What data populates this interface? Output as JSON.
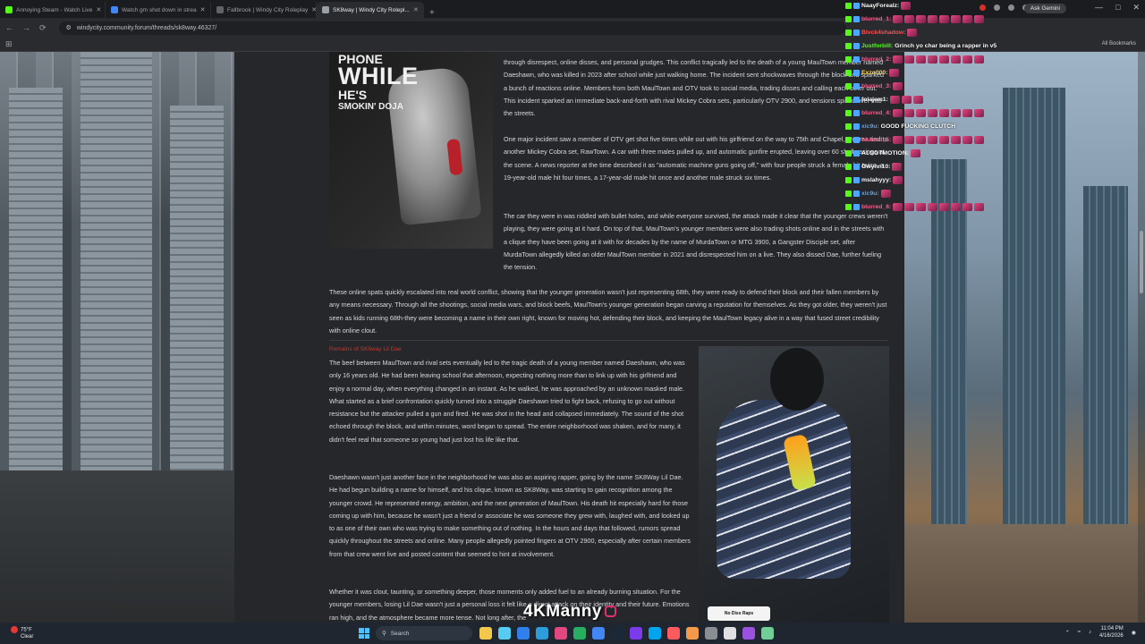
{
  "browser": {
    "tabs": [
      {
        "title": "Annoying Steam - Watch Live",
        "favicon_color": "#53fc18",
        "active": false
      },
      {
        "title": "Watch gm shot down in strea",
        "favicon_color": "#4285f4",
        "active": false
      },
      {
        "title": "Fallbrook | Windy City Roleplay",
        "favicon_color": "#5f6368",
        "active": false
      },
      {
        "title": "SK8way | Windy City Rolepl...",
        "favicon_color": "#9aa0a6",
        "active": true
      }
    ],
    "url": "windycity.community.forum/threads/sk8way.46327/",
    "ask_gemini": "Ask Gemini",
    "all_bookmarks": "All Bookmarks"
  },
  "image_top": {
    "line1": "PHONE",
    "line2": "WHILE",
    "line3": "HE'S",
    "line4": "SMOKIN' DOJA"
  },
  "post": {
    "paragraphs": [
      "through disrespect, online disses, and personal grudges. This conflict tragically led to the death of a young MaulTown member named Daeshawn, who was killed in 2023 after school while just walking home. The incident sent shockwaves through the block and sparked a bunch of reactions online. Members from both MaulTown and OTV took to social media, trading disses and calling each other out. This incident sparked an immediate back-and-forth with rival Mickey Cobra sets, particularly OTV 2900, and tensions spilled over into the streets.",
      "One major incident saw a member of OTV get shot five times while out with his girlfriend on the way to 75th and Chapel, an area tied to another Mickey Cobra set, RawTown. A car with three males pulled up, and automatic gunfire erupted, leaving over 60 shell casings at the scene. A news reporter at the time described it as \"automatic machine guns going off,\" with four people struck a female hit twice, a 19-year-old male hit four times, a 17-year-old male hit once and another male struck six times.",
      "The car they were in was riddled with bullet holes, and while everyone survived, the attack made it clear that the younger crews weren't playing, they were going at it hard. On top of that, MaulTown's younger members were also trading shots online and in the streets with a clique they have been going at it with for decades by the name of MurdaTown or MTG 3900, a Gangster Disciple set, after MurdaTown allegedly killed an older MaulTown member in 2021 and disrespected him on a live. They also dissed Dae, further fueling the tension.",
      "These online spats quickly escalated into real world conflict, showing that the younger generation wasn't just representing 68th, they were ready to defend their block and their fallen members by any means necessary. Through all the shootings, social media wars, and block beefs, MaulTown's younger generation began carving a reputation for themselves. As they got older, they weren't just seen as kids running 68th-they were becoming a name in their own right, known for moving hot, defending their block, and keeping the MaulTown legacy alive in a way that fused street credibility with online clout.",
      "The beef between MaulTown and rival sets eventually led to the tragic death of a young member named Daeshawn, who was only 16 years old. He had been leaving school that afternoon, expecting nothing more than to link up with his girlfriend and enjoy a normal day, when everything changed in an instant. As he walked, he was approached by an unknown masked male. What started as a brief confrontation quickly turned into a struggle Daeshawn tried to fight back, refusing to go out without resistance but the attacker pulled a gun and fired. He was shot in the head and collapsed immediately. The sound of the shot echoed through the block, and within minutes, word began to spread. The entire neighborhood was shaken, and for many, it didn't feel real that someone so young had just lost his life like that.",
      "Daeshawn wasn't just another face in the neighborhood he was also an aspiring rapper, going by the name SK8Way Lil Dae. He had begun building a name for himself, and his clique, known as SK8Way, was starting to gain recognition among the younger crowd. He represented energy, ambition, and the next generation of MaulTown. His death hit especially hard for those coming up with him, because he wasn't just a friend or associate he was someone they grew with, laughed with, and looked up to as one of their own who was trying to make something out of nothing. In the hours and days that followed, rumors spread quickly throughout the streets and online. Many people allegedly pointed fingers at OTV 2900, especially after certain members from that crew went live and posted content that seemed to hint at involvement.",
      "Whether it was clout, taunting, or something deeper, those moments only added fuel to an already burning situation. For the younger members, losing Lil Dae wasn't just a personal loss it felt like a direct attack on their identity and their future. Emotions ran high, and the atmosphere became more tense. Not long after, the"
    ],
    "caption": "Remains of SK8way Lil Dae",
    "sign_text": "No Diss Raps"
  },
  "chat": [
    {
      "user": "NaayForealz:",
      "color": "#f5f5f5",
      "msg": "",
      "emotes": 1
    },
    {
      "user": "blurred_1:",
      "color": "#ff5a8a",
      "msg": "",
      "emotes": 8
    },
    {
      "user": "Blvck4shadow:",
      "color": "#ff4d4d",
      "msg": "",
      "emotes": 1
    },
    {
      "user": "Justforbill:",
      "color": "#53fc18",
      "msg": "Grinch yo char being a rapper in v5",
      "emotes": 0
    },
    {
      "user": "blurred_2:",
      "color": "#ff5a8a",
      "msg": "",
      "emotes": 8
    },
    {
      "user": "Exzo000:",
      "color": "#ffd34d",
      "msg": "",
      "emotes": 1
    },
    {
      "user": "blurred_3:",
      "color": "#ff5a8a",
      "msg": "",
      "emotes": 1
    },
    {
      "user": "folajem1:",
      "color": "#f5f5f5",
      "msg": "",
      "emotes": 3
    },
    {
      "user": "blurred_4:",
      "color": "#ff5a8a",
      "msg": "",
      "emotes": 8
    },
    {
      "user": "xic9u:",
      "color": "#4da6ff",
      "msg": "GOOD FUCKING CLUTCH",
      "emotes": 0
    },
    {
      "user": "blurred_5:",
      "color": "#ff5a8a",
      "msg": "",
      "emotes": 8
    },
    {
      "user": "A1GOTMOTION:",
      "color": "#f5f5f5",
      "msg": "",
      "emotes": 1
    },
    {
      "user": "Gwynn10:",
      "color": "#f5f5f5",
      "msg": "",
      "emotes": 1
    },
    {
      "user": "mslahyyy:",
      "color": "#f5f5f5",
      "msg": "",
      "emotes": 1
    },
    {
      "user": "xic9u:",
      "color": "#4da6ff",
      "msg": "",
      "emotes": 1
    },
    {
      "user": "blurred_6:",
      "color": "#ff5a8a",
      "msg": "",
      "emotes": 8
    }
  ],
  "watermark": "4KManny",
  "taskbar": {
    "weather_temp": "75°F",
    "weather_desc": "Clear",
    "search_placeholder": "Search",
    "time": "11:04 PM",
    "date": "4/16/2026",
    "app_colors": [
      "#f2c94c",
      "#56ccf2",
      "#2f80ed",
      "#2d9cdb",
      "#e2487f",
      "#27ae60",
      "#4285f4",
      "#1b2838",
      "#7c3aed",
      "#00a4ef",
      "#ff5a5f",
      "#f2994a",
      "#8a8d92",
      "#e0e0e0",
      "#9b51e0",
      "#6fcf97"
    ]
  }
}
